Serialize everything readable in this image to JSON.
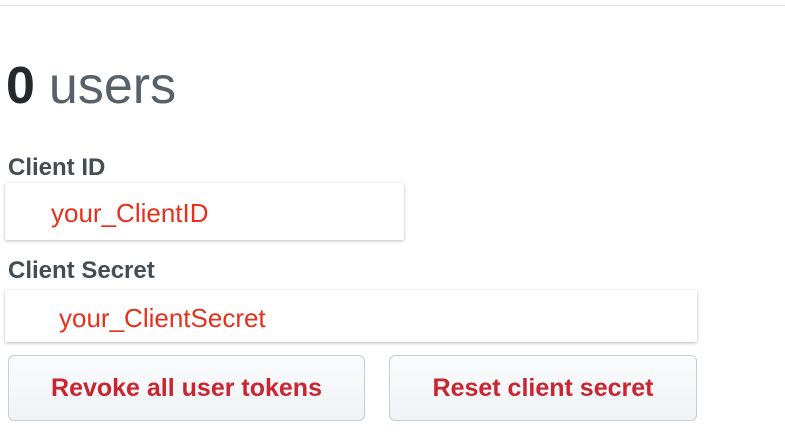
{
  "users": {
    "count": "0",
    "label": "users"
  },
  "client_id": {
    "label": "Client ID",
    "value": "your_ClientID"
  },
  "client_secret": {
    "label": "Client Secret",
    "value": "your_ClientSecret"
  },
  "actions": {
    "revoke_label": "Revoke all user tokens",
    "reset_label": "Reset client secret"
  },
  "colors": {
    "value_text": "#e5301c",
    "danger_button_text": "#cb2431",
    "heading_text": "#24292e",
    "muted_text": "#586069",
    "label_text": "#444d56"
  }
}
